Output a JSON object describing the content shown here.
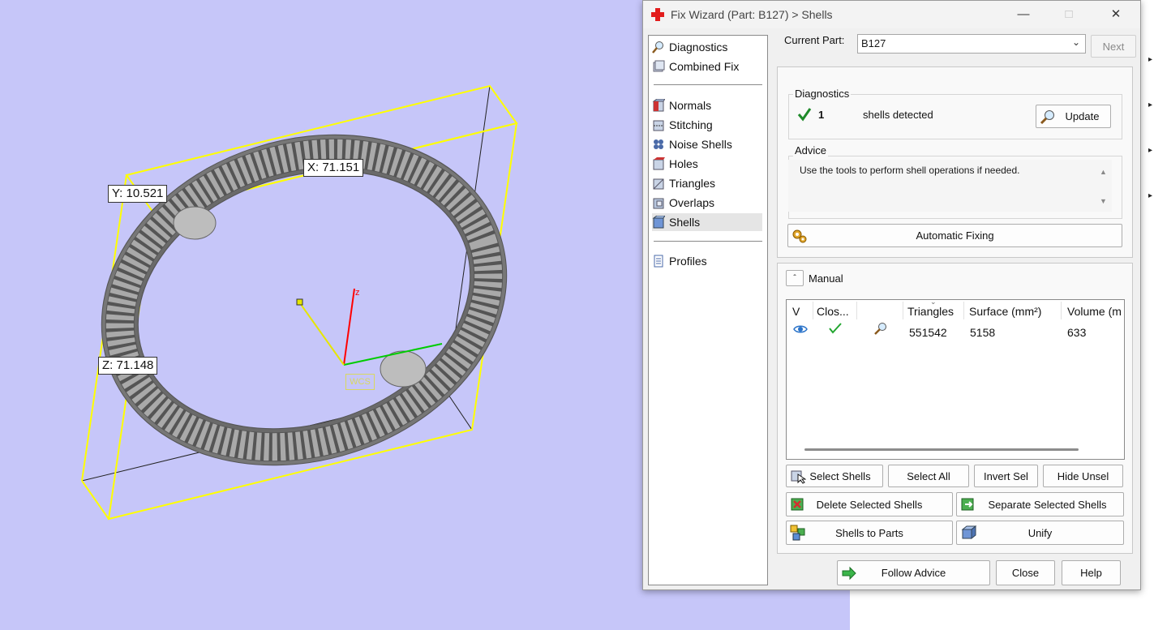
{
  "viewport": {
    "dim_y": "Y: 10.521",
    "dim_x": "X: 71.151",
    "dim_z": "Z: 71.148",
    "axis_z": "z",
    "wcs": "WCS",
    "colors": {
      "background": "#c6c6f9",
      "bounding_box": "#ffff00",
      "z_axis": "#ff0000",
      "x_axis": "#00cc00",
      "y_axis": "#e6e600"
    }
  },
  "dialog": {
    "title": "Fix Wizard (Part: B127) > Shells",
    "icon": "red-cross-icon",
    "nav": {
      "items": [
        {
          "label": "Diagnostics",
          "icon": "magnifier-icon"
        },
        {
          "label": "Combined Fix",
          "icon": "cubes-icon"
        },
        {
          "label": "Normals",
          "icon": "cube-red-face-icon"
        },
        {
          "label": "Stitching",
          "icon": "stitch-cube-icon"
        },
        {
          "label": "Noise Shells",
          "icon": "noise-shells-icon"
        },
        {
          "label": "Holes",
          "icon": "cube-red-face-icon"
        },
        {
          "label": "Triangles",
          "icon": "triangles-cube-icon"
        },
        {
          "label": "Overlaps",
          "icon": "overlaps-cube-icon"
        },
        {
          "label": "Shells",
          "icon": "blue-cube-icon"
        },
        {
          "label": "Profiles",
          "icon": "document-icon"
        }
      ],
      "active": "Shells"
    },
    "current_part_label": "Current Part:",
    "current_part_value": "B127",
    "next_label": "Next",
    "diagnostics": {
      "title": "Diagnostics",
      "count": "1",
      "message": "shells detected",
      "update_label": "Update"
    },
    "advice": {
      "title": "Advice",
      "text": "Use the tools to perform shell operations if needed."
    },
    "automatic_fixing_label": "Automatic Fixing",
    "manual": {
      "title": "Manual",
      "columns": [
        "V",
        "Clos...",
        "",
        "Triangles",
        "Surface (mm²)",
        "Volume (m"
      ],
      "rows": [
        {
          "triangles": "551542",
          "surface": "5158",
          "volume": "633"
        }
      ]
    },
    "buttons": {
      "select_shells": "Select Shells",
      "select_all": "Select All",
      "invert_sel": "Invert Sel",
      "hide_unsel": "Hide Unsel",
      "delete_selected": "Delete Selected Shells",
      "separate_selected": "Separate Selected Shells",
      "shells_to_parts": "Shells to Parts",
      "unify": "Unify",
      "follow_advice": "Follow Advice",
      "close": "Close",
      "help": "Help"
    }
  }
}
